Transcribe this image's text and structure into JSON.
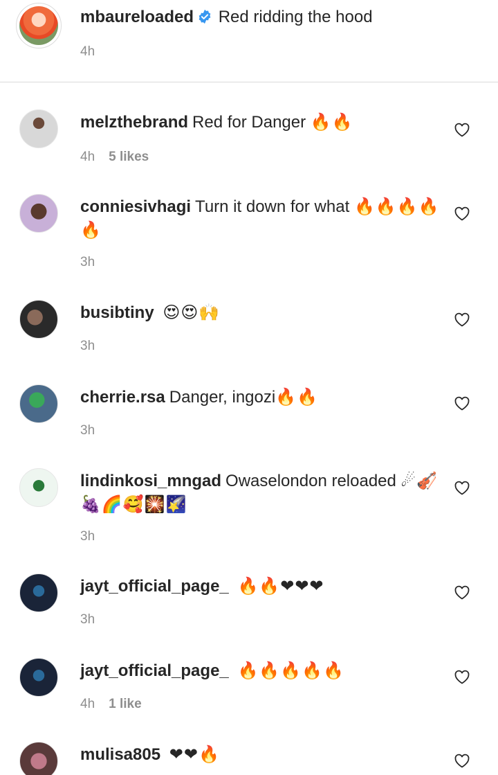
{
  "caption": {
    "username": "mbaureloaded",
    "text": "Red ridding the hood",
    "time": "4h"
  },
  "comments": [
    {
      "username": "melzthebrand",
      "text": "Red for Danger",
      "emoji": "🔥🔥",
      "time": "4h",
      "likes": "5 likes"
    },
    {
      "username": "conniesivhagi",
      "text": "Turn it down for what",
      "emoji": "🔥🔥🔥🔥🔥",
      "time": "3h",
      "likes": ""
    },
    {
      "username": "busibtiny",
      "text": "",
      "emoji": "😍😍🙌",
      "time": "3h",
      "likes": ""
    },
    {
      "username": "cherrie.rsa",
      "text": "Danger, ingozi",
      "emoji": "🔥🔥",
      "time": "3h",
      "likes": ""
    },
    {
      "username": "lindinkosi_mngad",
      "text": "Owaselondon reloaded",
      "emoji": "☄🎻🍇🌈🥰🎇🌠",
      "time": "3h",
      "likes": ""
    },
    {
      "username": "jayt_official_page_",
      "text": "",
      "emoji": "🔥🔥❤❤❤",
      "time": "3h",
      "likes": ""
    },
    {
      "username": "jayt_official_page_",
      "text": "",
      "emoji": "🔥🔥🔥🔥🔥",
      "time": "4h",
      "likes": "1 like"
    },
    {
      "username": "mulisa805",
      "text": "",
      "emoji": "❤❤🔥",
      "time": "",
      "likes": ""
    }
  ],
  "colors": {
    "text": "#262626",
    "muted": "#8e8e8e",
    "verified": "#3897f0",
    "divider": "#dbdbdb"
  },
  "icons": {
    "verified": "verified-badge-icon",
    "like": "heart-outline-icon"
  }
}
